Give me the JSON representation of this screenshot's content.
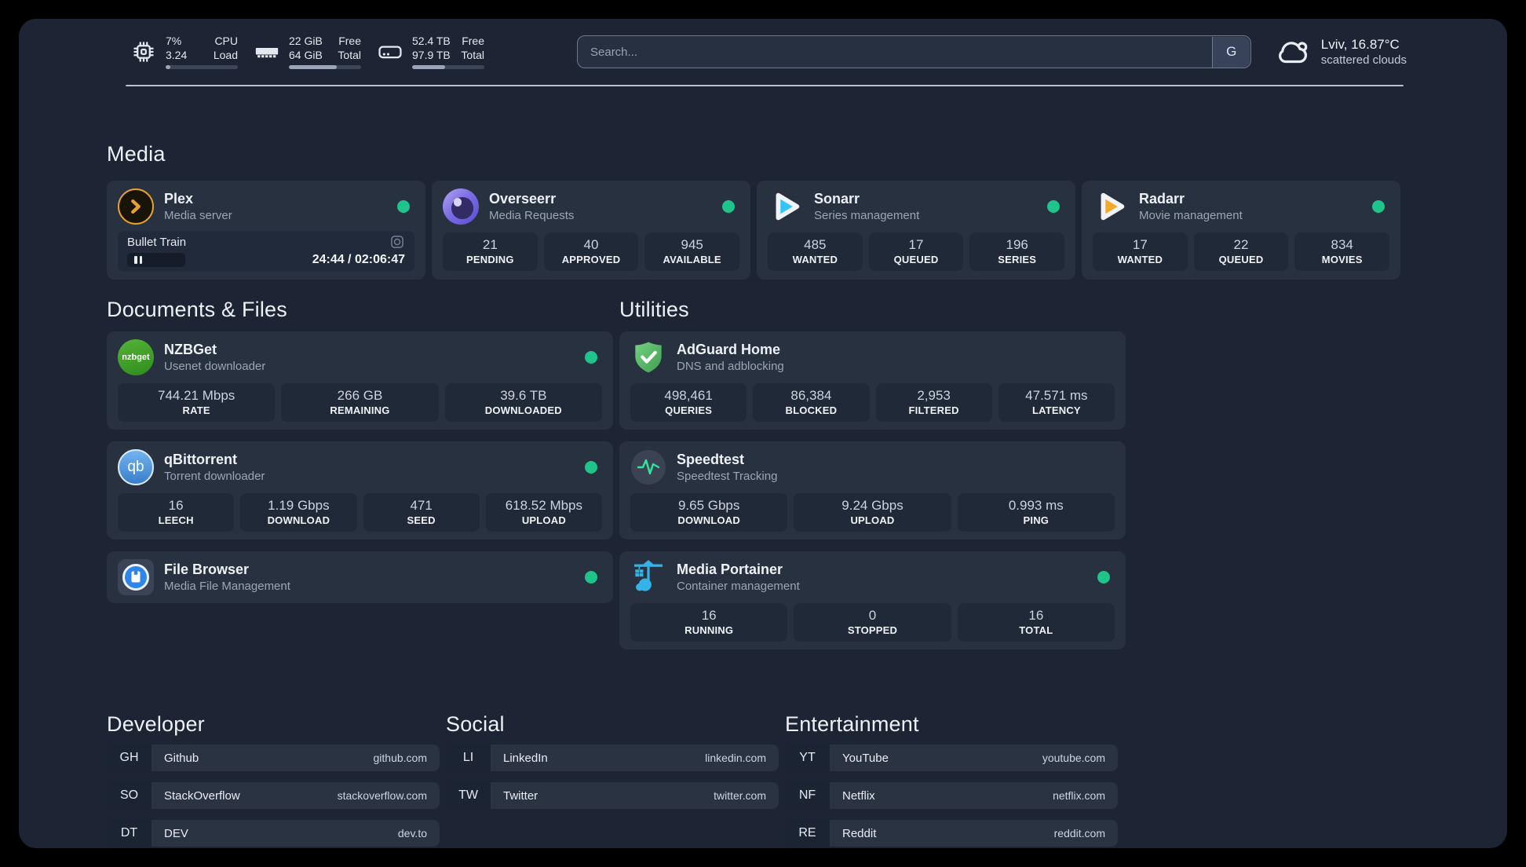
{
  "colors": {
    "background": "#1d2535",
    "card": "#283140",
    "stat_box": "#1f2938",
    "status_online_green": "#1fc48a",
    "plex_amber": "#e8a22b",
    "overseerr_purple": "#7d6ee4",
    "sonarr_blue": "#35c5f4",
    "radarr_amber": "#f5a928",
    "nzbget_green": "#46a22a",
    "qbittorrent_blue": "#4a8fd4",
    "adguard_green": "#5fc26d",
    "speedtest_pulse_green": "#2ee59d",
    "portainer_blue": "#33b3e7",
    "filebrowser_blue": "#2f86ea"
  },
  "header": {
    "resources": [
      {
        "icon": "cpu-icon",
        "left_top": "7%",
        "left_bottom": "3.24",
        "right_top": "CPU",
        "right_bottom": "Load",
        "progress": 7
      },
      {
        "icon": "memory-icon",
        "left_top": "22 GiB",
        "left_bottom": "64 GiB",
        "right_top": "Free",
        "right_bottom": "Total",
        "progress": 66
      },
      {
        "icon": "disk-icon",
        "left_top": "52.4 TB",
        "left_bottom": "97.9 TB",
        "right_top": "Free",
        "right_bottom": "Total",
        "progress": 46
      }
    ],
    "search": {
      "placeholder": "Search...",
      "button_label": "G"
    },
    "weather": {
      "location": "Lviv, 16.87°C",
      "condition": "scattered clouds"
    }
  },
  "media": {
    "title": "Media",
    "plex": {
      "name": "Plex",
      "desc": "Media server",
      "online": true,
      "now_playing": {
        "title": "Bullet Train",
        "state": "paused",
        "time": "24:44 / 02:06:47"
      }
    },
    "cards": [
      {
        "name": "Overseerr",
        "desc": "Media Requests",
        "online": true,
        "stats": [
          {
            "value": "21",
            "label": "PENDING"
          },
          {
            "value": "40",
            "label": "APPROVED"
          },
          {
            "value": "945",
            "label": "AVAILABLE"
          }
        ]
      },
      {
        "name": "Sonarr",
        "desc": "Series management",
        "online": true,
        "stats": [
          {
            "value": "485",
            "label": "WANTED"
          },
          {
            "value": "17",
            "label": "QUEUED"
          },
          {
            "value": "196",
            "label": "SERIES"
          }
        ]
      },
      {
        "name": "Radarr",
        "desc": "Movie management",
        "online": true,
        "stats": [
          {
            "value": "17",
            "label": "WANTED"
          },
          {
            "value": "22",
            "label": "QUEUED"
          },
          {
            "value": "834",
            "label": "MOVIES"
          }
        ]
      }
    ]
  },
  "documents": {
    "title": "Documents & Files",
    "cards": [
      {
        "name": "NZBGet",
        "desc": "Usenet downloader",
        "online": true,
        "icon_label": "nzbget",
        "stats": [
          {
            "value": "744.21 Mbps",
            "label": "RATE"
          },
          {
            "value": "266 GB",
            "label": "REMAINING"
          },
          {
            "value": "39.6 TB",
            "label": "DOWNLOADED"
          }
        ]
      },
      {
        "name": "qBittorrent",
        "desc": "Torrent downloader",
        "online": true,
        "icon_label": "qb",
        "stats": [
          {
            "value": "16",
            "label": "LEECH"
          },
          {
            "value": "1.19 Gbps",
            "label": "DOWNLOAD"
          },
          {
            "value": "471",
            "label": "SEED"
          },
          {
            "value": "618.52 Mbps",
            "label": "UPLOAD"
          }
        ]
      },
      {
        "name": "File Browser",
        "desc": "Media File Management",
        "online": true,
        "stats": []
      }
    ]
  },
  "utilities": {
    "title": "Utilities",
    "cards": [
      {
        "name": "AdGuard Home",
        "desc": "DNS and adblocking",
        "stats": [
          {
            "value": "498,461",
            "label": "QUERIES"
          },
          {
            "value": "86,384",
            "label": "BLOCKED"
          },
          {
            "value": "2,953",
            "label": "FILTERED"
          },
          {
            "value": "47.571 ms",
            "label": "LATENCY"
          }
        ]
      },
      {
        "name": "Speedtest",
        "desc": "Speedtest Tracking",
        "stats": [
          {
            "value": "9.65 Gbps",
            "label": "DOWNLOAD"
          },
          {
            "value": "9.24 Gbps",
            "label": "UPLOAD"
          },
          {
            "value": "0.993 ms",
            "label": "PING"
          }
        ]
      },
      {
        "name": "Media Portainer",
        "desc": "Container management",
        "online": true,
        "stats": [
          {
            "value": "16",
            "label": "RUNNING"
          },
          {
            "value": "0",
            "label": "STOPPED"
          },
          {
            "value": "16",
            "label": "TOTAL"
          }
        ]
      }
    ]
  },
  "bookmarks": [
    {
      "title": "Developer",
      "links": [
        {
          "abbr": "GH",
          "name": "Github",
          "url": "github.com"
        },
        {
          "abbr": "SO",
          "name": "StackOverflow",
          "url": "stackoverflow.com"
        },
        {
          "abbr": "DT",
          "name": "DEV",
          "url": "dev.to"
        }
      ]
    },
    {
      "title": "Social",
      "links": [
        {
          "abbr": "LI",
          "name": "LinkedIn",
          "url": "linkedin.com"
        },
        {
          "abbr": "TW",
          "name": "Twitter",
          "url": "twitter.com"
        }
      ]
    },
    {
      "title": "Entertainment",
      "links": [
        {
          "abbr": "YT",
          "name": "YouTube",
          "url": "youtube.com"
        },
        {
          "abbr": "NF",
          "name": "Netflix",
          "url": "netflix.com"
        },
        {
          "abbr": "RE",
          "name": "Reddit",
          "url": "reddit.com"
        }
      ]
    }
  ]
}
